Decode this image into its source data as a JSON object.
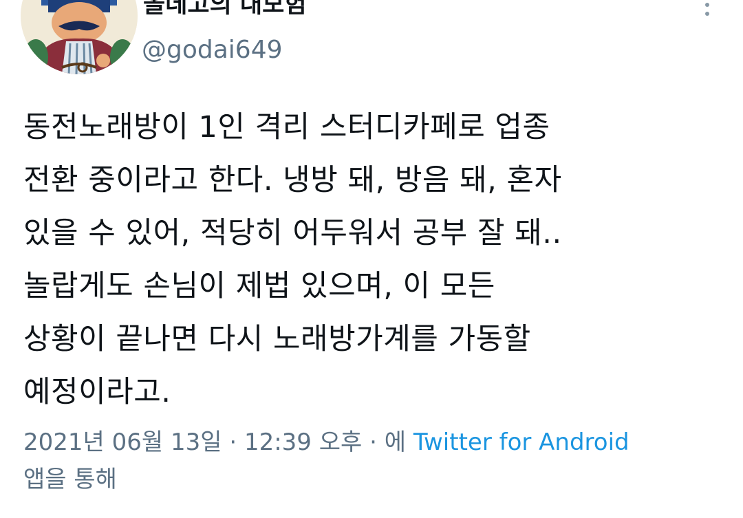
{
  "author": {
    "display_name": "올데고의 대모험",
    "handle": "@godai649"
  },
  "tweet": {
    "lines": [
      "동전노래방이 1인 격리 스터디카페로 업종",
      "전환 중이라고 한다. 냉방 돼, 방음 돼, 혼자",
      "있을 수 있어,  적당히 어두워서 공부 잘 돼..",
      "놀랍게도 손님이 제법 있으며, 이 모든",
      "상황이 끝나면 다시 노래방가계를 가동할",
      "예정이라고."
    ]
  },
  "meta": {
    "date": "2021년 06월 13일",
    "separator": " · ",
    "time": "12:39 오후",
    "via_prefix": "에 ",
    "source": "Twitter for Android",
    "via_suffix": "앱을 통해"
  },
  "icons": {
    "more": "more-vertical-icon"
  },
  "colors": {
    "text": "#0f1419",
    "secondary": "#5b7083",
    "link": "#1b95e0"
  }
}
